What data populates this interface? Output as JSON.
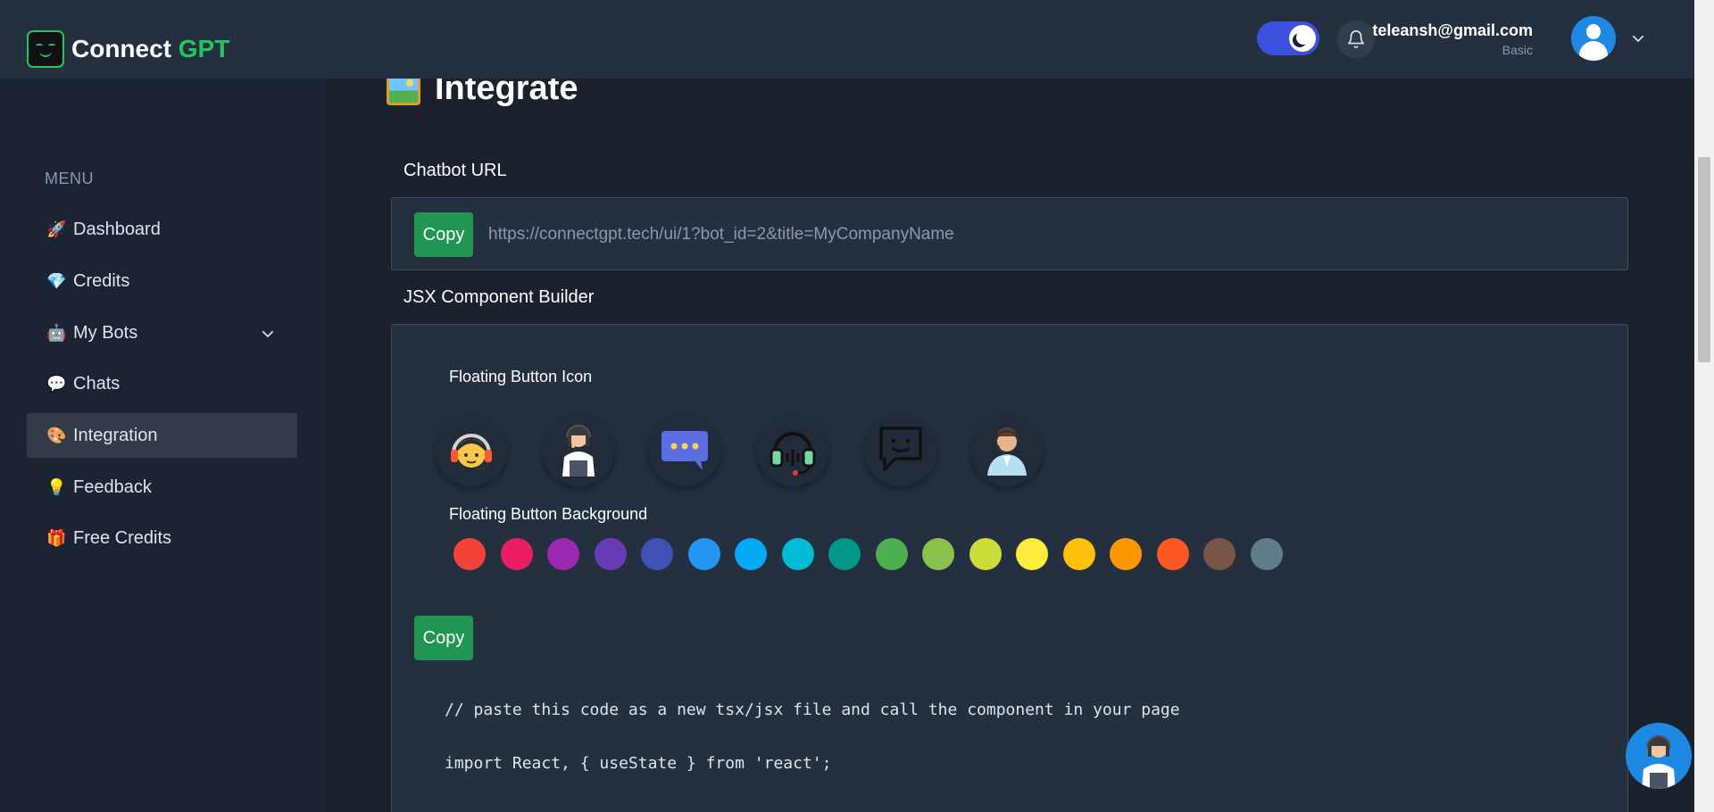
{
  "header": {
    "logo_main": "Connect ",
    "logo_accent": "GPT",
    "user_email": "teleansh@gmail.com",
    "user_plan": "Basic"
  },
  "sidebar": {
    "menu_label": "MENU",
    "items": [
      {
        "label": "Dashboard",
        "emoji": "🚀"
      },
      {
        "label": "Credits",
        "emoji": "💎"
      },
      {
        "label": "My Bots",
        "emoji": "🤖"
      },
      {
        "label": "Chats",
        "emoji": "💬"
      },
      {
        "label": "Integration",
        "emoji": "🎨"
      },
      {
        "label": "Feedback",
        "emoji": "💡"
      },
      {
        "label": "Free Credits",
        "emoji": "🎁"
      }
    ],
    "active_index": 4
  },
  "main": {
    "title": "Integrate",
    "chatbot_url_label": "Chatbot URL",
    "copy_label": "Copy",
    "chatbot_url": "https://connectgpt.tech/ui/1?bot_id=2&title=MyCompanyName",
    "jsx_builder_label": "JSX Component Builder",
    "floating_icon_label": "Floating Button Icon",
    "floating_bg_label": "Floating Button Background",
    "icon_options": [
      "support-agent-headset-icon",
      "female-support-agent-icon",
      "chat-bubble-dots-icon",
      "headset-icon",
      "chat-smile-icon",
      "male-support-agent-icon"
    ],
    "color_options": [
      "#f44336",
      "#e91e63",
      "#9c27b0",
      "#673ab7",
      "#3f51b5",
      "#2196f3",
      "#03a9f4",
      "#00bcd4",
      "#009688",
      "#4caf50",
      "#8bc34a",
      "#cddc39",
      "#ffeb3b",
      "#ffc107",
      "#ff9800",
      "#ff5722",
      "#795548",
      "#607d8b"
    ],
    "code_lines": [
      "// paste this code as a new tsx/jsx file and call the component in your page",
      "import React, { useState } from 'react';"
    ]
  },
  "colors": {
    "accent_green": "#22c55e",
    "button_green": "#219653",
    "toggle_blue": "#3c50e0"
  }
}
